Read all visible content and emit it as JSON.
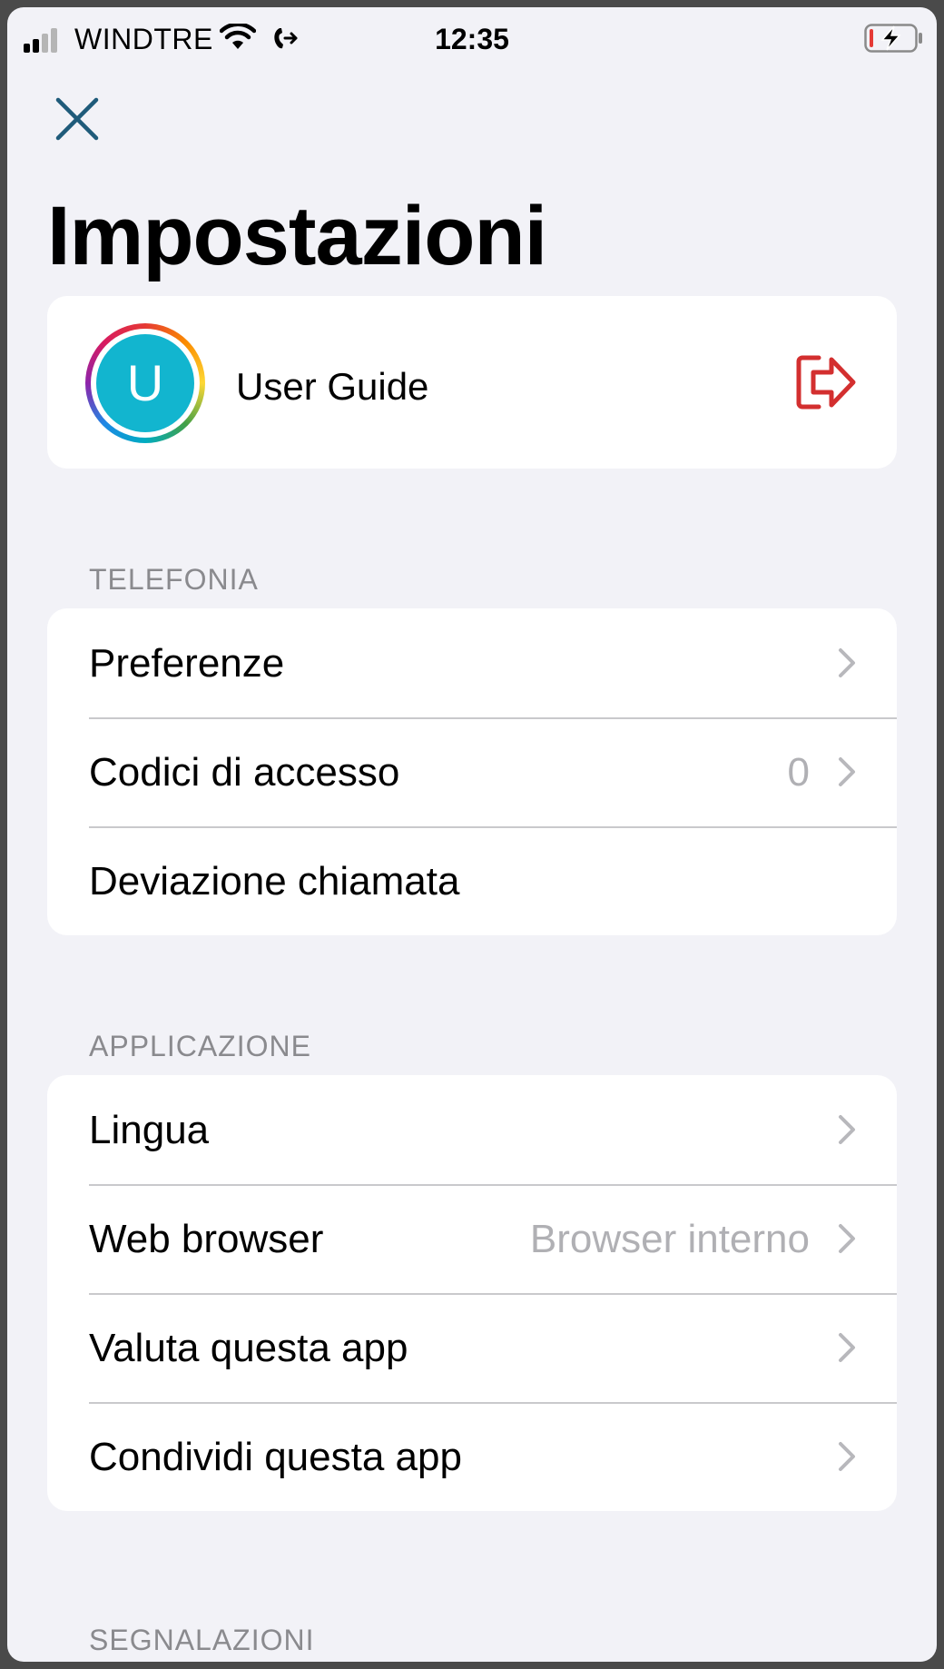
{
  "status_bar": {
    "carrier": "WINDTRE",
    "time": "12:35",
    "signal_bars_filled": 2,
    "signal_bars_total": 4,
    "wifi_icon": "wifi-icon",
    "call_forward_icon": "call-forward-icon",
    "battery_icon": "battery-charging-low-icon"
  },
  "header": {
    "title": "Impostazioni",
    "close_icon": "close-icon"
  },
  "profile": {
    "avatar_initial": "U",
    "name": "User Guide",
    "logout_icon": "logout-icon"
  },
  "sections": {
    "telefonia": {
      "header": "TELEFONIA",
      "items": [
        {
          "label": "Preferenze",
          "value": "",
          "chevron": true
        },
        {
          "label": "Codici di accesso",
          "value": "0",
          "chevron": true
        },
        {
          "label": "Deviazione chiamata",
          "value": "",
          "chevron": false
        }
      ]
    },
    "applicazione": {
      "header": "APPLICAZIONE",
      "items": [
        {
          "label": "Lingua",
          "value": "",
          "chevron": true
        },
        {
          "label": "Web browser",
          "value": "Browser interno",
          "chevron": true
        },
        {
          "label": "Valuta questa app",
          "value": "",
          "chevron": true
        },
        {
          "label": "Condividi questa app",
          "value": "",
          "chevron": true
        }
      ]
    },
    "segnalazioni": {
      "header": "SEGNALAZIONI"
    }
  },
  "colors": {
    "background": "#f2f2f7",
    "accent_close": "#1f5b7a",
    "logout": "#d32f2f",
    "avatar": "#12b5cf",
    "secondary_text": "#8a8a8e"
  }
}
